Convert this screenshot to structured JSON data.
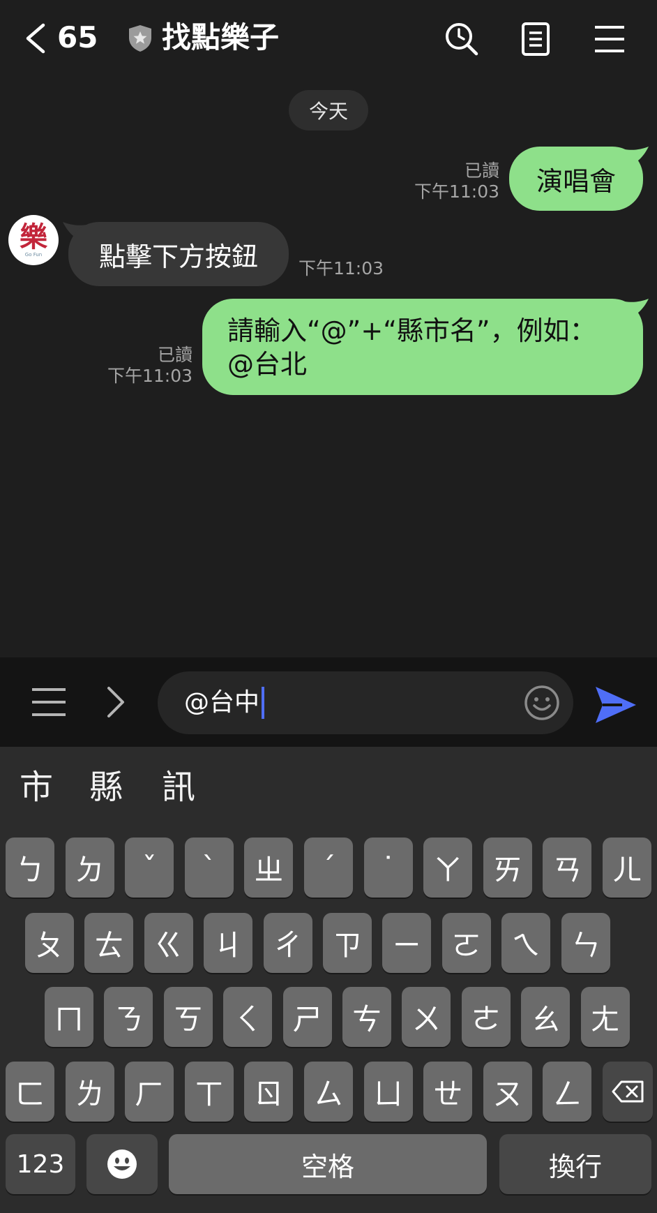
{
  "header": {
    "unread_count": "65",
    "title": "找點樂子",
    "icons": [
      "back-icon",
      "shield-icon",
      "search-clock-icon",
      "notes-icon",
      "menu-icon"
    ]
  },
  "date_divider": "今天",
  "messages": [
    {
      "direction": "out",
      "text": "演唱會",
      "read": "已讀",
      "time": "下午11:03"
    },
    {
      "direction": "in",
      "text": "點擊下方按鈕",
      "time": "下午11:03",
      "avatar_text": "樂",
      "avatar_sub": "Go Fun"
    },
    {
      "direction": "out",
      "line1": "請輸入“@”+“縣市名”，例如：",
      "line2": "@台北",
      "read": "已讀",
      "time": "下午11:03"
    }
  ],
  "input": {
    "value": "@台中",
    "icons": [
      "menu-icon",
      "chevron-right-icon",
      "smile-icon",
      "send-icon"
    ]
  },
  "keyboard": {
    "candidates": [
      "市",
      "縣",
      "訊"
    ],
    "row1": [
      "ㄅ",
      "ㄉ",
      "ˇ",
      "ˋ",
      "ㄓ",
      "ˊ",
      "˙",
      "ㄚ",
      "ㄞ",
      "ㄢ",
      "ㄦ"
    ],
    "row2": [
      "ㄆ",
      "ㄊ",
      "ㄍ",
      "ㄐ",
      "ㄔ",
      "ㄗ",
      "ㄧ",
      "ㄛ",
      "ㄟ",
      "ㄣ"
    ],
    "row3": [
      "ㄇ",
      "ㄋ",
      "ㄎ",
      "ㄑ",
      "ㄕ",
      "ㄘ",
      "ㄨ",
      "ㄜ",
      "ㄠ",
      "ㄤ"
    ],
    "row4": [
      "ㄈ",
      "ㄌ",
      "ㄏ",
      "ㄒ",
      "ㄖ",
      "ㄙ",
      "ㄩ",
      "ㄝ",
      "ㄡ",
      "ㄥ"
    ],
    "numbers_label": "123",
    "space_label": "空格",
    "return_label": "換行",
    "key_color": "#6b6b6b",
    "accent_send": "#4f6ef7",
    "bubble_out_color": "#8ee08a"
  }
}
